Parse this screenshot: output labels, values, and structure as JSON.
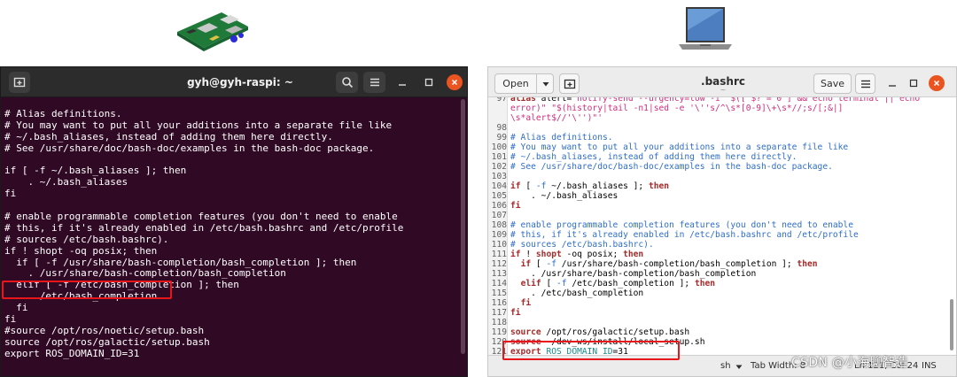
{
  "terminal": {
    "title": "gyh@gyh-raspi: ~",
    "lines": [
      "# Alias definitions.",
      "# You may want to put all your additions into a separate file like",
      "# ~/.bash_aliases, instead of adding them here directly.",
      "# See /usr/share/doc/bash-doc/examples in the bash-doc package.",
      "",
      "if [ -f ~/.bash_aliases ]; then",
      "    . ~/.bash_aliases",
      "fi",
      "",
      "# enable programmable completion features (you don't need to enable",
      "# this, if it's already enabled in /etc/bash.bashrc and /etc/profile",
      "# sources /etc/bash.bashrc).",
      "if ! shopt -oq posix; then",
      "  if [ -f /usr/share/bash-completion/bash_completion ]; then",
      "    . /usr/share/bash-completion/bash_completion",
      "  elif [ -f /etc/bash_completion ]; then",
      "    . /etc/bash_completion",
      "  fi",
      "fi",
      "#source /opt/ros/noetic/setup.bash",
      "source /opt/ros/galactic/setup.bash",
      "export ROS_DOMAIN_ID=31"
    ]
  },
  "editor": {
    "open_label": "Open",
    "title": ".bashrc",
    "title_sub": "~",
    "save_label": "Save",
    "status": {
      "language": "sh",
      "tab_width": "Tab Width: 8",
      "position": "Ln 121, Col 24",
      "mode": "INS"
    },
    "lines": [
      {
        "n": "97",
        "segs": [
          [
            "kw",
            "alias"
          ],
          [
            "pl",
            " alert="
          ],
          [
            "str",
            "'notify-send --urgency=low -i \"$([ $? = 0 ] && echo terminal || echo"
          ]
        ]
      },
      {
        "n": "",
        "segs": [
          [
            "str",
            "error)\" \"$(history|tail -n1|sed -e '\\''s/^\\s*[0-9]\\+\\s*//;s/[;&|]"
          ]
        ]
      },
      {
        "n": "",
        "segs": [
          [
            "str",
            "\\s*alert$//'\\'')\"'"
          ]
        ]
      },
      {
        "n": "98",
        "segs": []
      },
      {
        "n": "99",
        "segs": [
          [
            "cmt",
            "# Alias definitions."
          ]
        ]
      },
      {
        "n": "100",
        "segs": [
          [
            "cmt",
            "# You may want to put all your additions into a separate file like"
          ]
        ]
      },
      {
        "n": "101",
        "segs": [
          [
            "cmt",
            "# ~/.bash_aliases, instead of adding them here directly."
          ]
        ]
      },
      {
        "n": "102",
        "segs": [
          [
            "cmt",
            "# See /usr/share/doc/bash-doc/examples in the bash-doc package."
          ]
        ]
      },
      {
        "n": "103",
        "segs": []
      },
      {
        "n": "104",
        "segs": [
          [
            "kw",
            "if"
          ],
          [
            "pl",
            " [ "
          ],
          [
            "cmt",
            "-f"
          ],
          [
            "pl",
            " ~/.bash_aliases ]; "
          ],
          [
            "kw",
            "then"
          ]
        ]
      },
      {
        "n": "105",
        "segs": [
          [
            "pl",
            "    . ~/.bash_aliases"
          ]
        ]
      },
      {
        "n": "106",
        "segs": [
          [
            "kw",
            "fi"
          ]
        ]
      },
      {
        "n": "107",
        "segs": []
      },
      {
        "n": "108",
        "segs": [
          [
            "cmt",
            "# enable programmable completion features (you don't need to enable"
          ]
        ]
      },
      {
        "n": "109",
        "segs": [
          [
            "cmt",
            "# this, if it's already enabled in /etc/bash.bashrc and /etc/profile"
          ]
        ]
      },
      {
        "n": "110",
        "segs": [
          [
            "cmt",
            "# sources /etc/bash.bashrc)."
          ]
        ]
      },
      {
        "n": "111",
        "segs": [
          [
            "kw",
            "if"
          ],
          [
            "pl",
            " ! "
          ],
          [
            "kw",
            "shopt"
          ],
          [
            "pl",
            " -oq posix; "
          ],
          [
            "kw",
            "then"
          ]
        ]
      },
      {
        "n": "112",
        "segs": [
          [
            "pl",
            "  "
          ],
          [
            "kw",
            "if"
          ],
          [
            "pl",
            " [ "
          ],
          [
            "cmt",
            "-f"
          ],
          [
            "pl",
            " /usr/share/bash-completion/bash_completion ]; "
          ],
          [
            "kw",
            "then"
          ]
        ]
      },
      {
        "n": "113",
        "segs": [
          [
            "pl",
            "    . /usr/share/bash-completion/bash_completion"
          ]
        ]
      },
      {
        "n": "114",
        "segs": [
          [
            "pl",
            "  "
          ],
          [
            "kw",
            "elif"
          ],
          [
            "pl",
            " [ "
          ],
          [
            "cmt",
            "-f"
          ],
          [
            "pl",
            " /etc/bash_completion ]; "
          ],
          [
            "kw",
            "then"
          ]
        ]
      },
      {
        "n": "115",
        "segs": [
          [
            "pl",
            "    . /etc/bash_completion"
          ]
        ]
      },
      {
        "n": "116",
        "segs": [
          [
            "pl",
            "  "
          ],
          [
            "kw",
            "fi"
          ]
        ]
      },
      {
        "n": "117",
        "segs": [
          [
            "kw",
            "fi"
          ]
        ]
      },
      {
        "n": "118",
        "segs": []
      },
      {
        "n": "119",
        "segs": [
          [
            "kw",
            "source"
          ],
          [
            "pl",
            " /opt/ros/galactic/setup.bash"
          ]
        ]
      },
      {
        "n": "120",
        "segs": [
          [
            "kw",
            "source"
          ],
          [
            "pl",
            " ~/dev_ws/install/local_setup.sh"
          ]
        ]
      },
      {
        "n": "121",
        "segs": [
          [
            "kw",
            "export"
          ],
          [
            "pl",
            " "
          ],
          [
            "var",
            "ROS_DOMAIN_ID"
          ],
          [
            "pl",
            "=31"
          ]
        ]
      }
    ]
  },
  "watermark": "CSDN @小海聊智造",
  "icons": {
    "raspberry_pi": "raspberry-pi-board",
    "laptop": "laptop"
  },
  "colors": {
    "terminal_bg": "#300a24",
    "highlight_box": "#e8161b",
    "close_button": "#e95420"
  }
}
